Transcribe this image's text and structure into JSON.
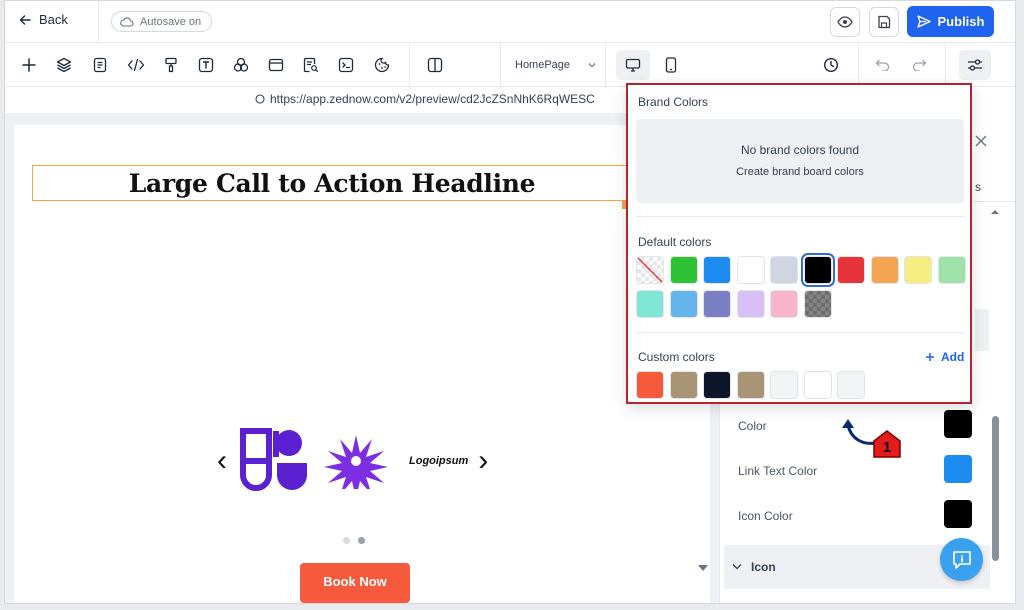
{
  "topbar": {
    "back_label": "Back",
    "autosave_label": "Autosave on",
    "publish_label": "Publish"
  },
  "toolbar": {
    "page_select_value": "HomePage"
  },
  "urlbar": {
    "url": "https://app.zednow.com/v2/preview/cd2JcZSnNhK6RqWESC"
  },
  "canvas": {
    "headline": "Large Call to Action Headline",
    "logo_text": "Logoipsum",
    "carousel_prev": "‹",
    "carousel_next": "›",
    "cta_label": "Book Now"
  },
  "right_panel": {
    "tab_partial": "s",
    "color_label": "Color",
    "link_text_color_label": "Link Text Color",
    "icon_color_label": "Icon Color",
    "icon_section_label": "Icon",
    "color_value": "#000000",
    "link_text_color_value": "#1d8cf0",
    "icon_color_value": "#000000"
  },
  "color_picker": {
    "brand_title": "Brand Colors",
    "no_brand_text": "No brand colors found",
    "create_brand_link": "Create brand board colors",
    "default_title": "Default colors",
    "custom_title": "Custom colors",
    "add_label": "Add",
    "default_colors": [
      "transparent",
      "#2ec234",
      "#1d8cf0",
      "#ffffff",
      "#cfd6e0",
      "#000000",
      "#e6353a",
      "#f5a552",
      "#f7ee82",
      "#9ee2aa",
      "#80e6d8",
      "#64b4ee",
      "#7b7fc4",
      "#d8bff5",
      "#f8b6cc",
      "#7a7a7a"
    ],
    "selected_default_index": 5,
    "custom_colors": [
      "#f55a3c",
      "#a99476",
      "#0f1629",
      "#a99476",
      "#f3f4f6",
      "#ffffff",
      "#f3f4f6"
    ]
  },
  "annotation": {
    "callout_number": "1"
  }
}
